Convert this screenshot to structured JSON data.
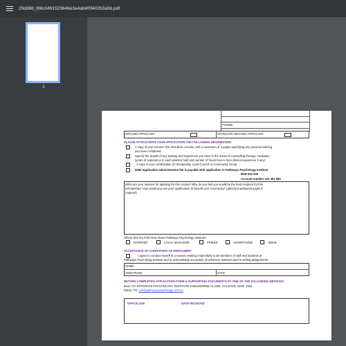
{
  "toolbar": {
    "title": "29dd88_f88c0491523646e3a4ab4f0f402b3a5b.pdf"
  },
  "sidebar": {
    "page_number": "1"
  },
  "form": {
    "phone_label": "PHONE:",
    "diploma_applicant": "DIPLOMA APPLICANT",
    "graduate_diploma_applicant": "GRADUATE DIPLOMA APPLICANT",
    "attach_heading": "PLEASE ATTACH WITH YOUR APPLICATION THE FOLLOWING INFORMATION",
    "attach_items": [
      "A copy of your resume: this should be concise, with a maximum of 4 pages specifying any previous training",
      "you have completed.",
      "Specify the details of any training and experience you have in the areas of counselling therapy, mediation",
      "(years of experience in each position held and number of hours face to face clinical experience if any).",
      "A copy of your confirmation of Aboriginality. Land Council or Community Group",
      "$250 Application administration fee is payable with application to Pathways Psychology Institute",
      "BSB 633 000",
      "Account number 151 451 069"
    ],
    "question": [
      "What are your reasons for applying for this course? Why do you feel you would be the best recipient for this",
      "scholarship? How would you use your qualification to benefit your community? (attached additional pages if",
      "required)"
    ],
    "heard_label": "Where Did You First Hear About Pathways Psychology Institute?",
    "heard_options": [
      "INTERNET",
      "LOCAL MAGAZINE",
      "FRIEND",
      "ADVERTISING",
      "EMAIL"
    ],
    "acceptance_heading": "ACCEPTANCE OF CONDITIONS OF ENROLMENT",
    "acceptance_text": [
      "I agree to conduct myself in a manner relating respectfully to all members of staff and students at",
      "Pathways Psychology Institute and to acknowledge accurately all reference material used in writing assignments."
    ],
    "name_label": "NAME:",
    "signature_label": "SIGNATURE:",
    "date_label": "DATE:",
    "return_heading": "RETURN COMPLETED APPLICATION FORM & SUPPORTING DOCUMENTS BY ONE OF THE FOLLOWING METHODS",
    "mail_to": "MAIL TO: PATHWAYS PSYCHOLOGY INSTITUTE 6 BELBOWRIE CLOSE, GALSTON, NSW, 2159",
    "email_to_label": "EMAIL TO:",
    "email_address": "info@pathwayspsychology.com.au",
    "office_use": "OFFICE USE",
    "date_received": "DATE RECIEVED"
  }
}
